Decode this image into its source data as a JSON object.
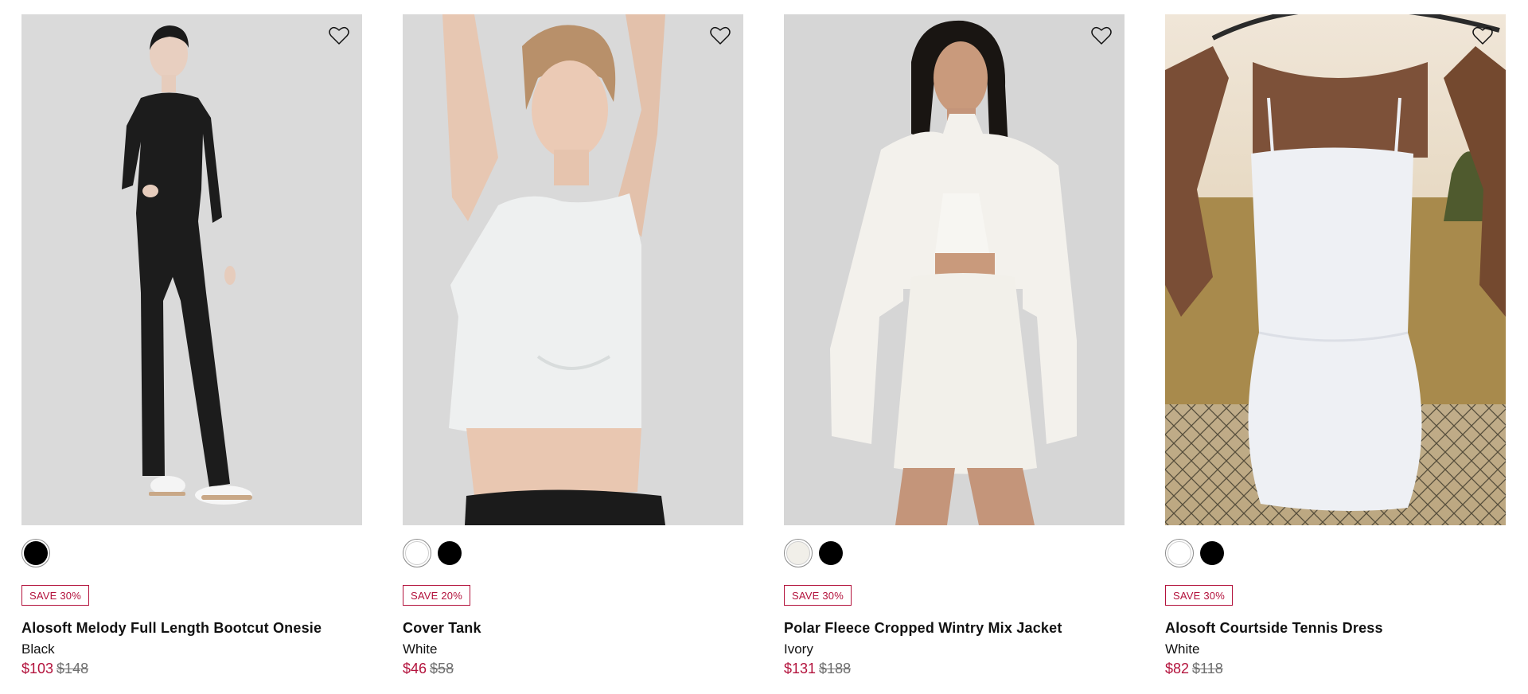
{
  "products": [
    {
      "name": "Alosoft Melody Full Length Bootcut Onesie",
      "color": "Black",
      "badge": "SAVE 30%",
      "sale_price": "$103",
      "original_price": "$148",
      "swatches": [
        {
          "color": "#000000",
          "selected": true
        }
      ],
      "image_bg": "#dadada",
      "wishlist_icon": "heart-icon"
    },
    {
      "name": "Cover Tank",
      "color": "White",
      "badge": "SAVE 20%",
      "sale_price": "$46",
      "original_price": "$58",
      "swatches": [
        {
          "color": "#ffffff",
          "selected": true
        },
        {
          "color": "#000000",
          "selected": false
        }
      ],
      "image_bg": "#d9d9d9",
      "wishlist_icon": "heart-icon"
    },
    {
      "name": "Polar Fleece Cropped Wintry Mix Jacket",
      "color": "Ivory",
      "badge": "SAVE 30%",
      "sale_price": "$131",
      "original_price": "$188",
      "swatches": [
        {
          "color": "#f1efe9",
          "selected": true
        },
        {
          "color": "#000000",
          "selected": false
        }
      ],
      "image_bg": "#d6d6d6",
      "wishlist_icon": "heart-icon"
    },
    {
      "name": "Alosoft Courtside Tennis Dress",
      "color": "White",
      "badge": "SAVE 30%",
      "sale_price": "$82",
      "original_price": "$118",
      "swatches": [
        {
          "color": "#ffffff",
          "selected": true
        },
        {
          "color": "#000000",
          "selected": false
        }
      ],
      "image_bg": "#b89a5a",
      "wishlist_icon": "heart-icon"
    }
  ],
  "colors": {
    "sale_red": "#b3123c",
    "strike_gray": "#6f6f6f"
  }
}
